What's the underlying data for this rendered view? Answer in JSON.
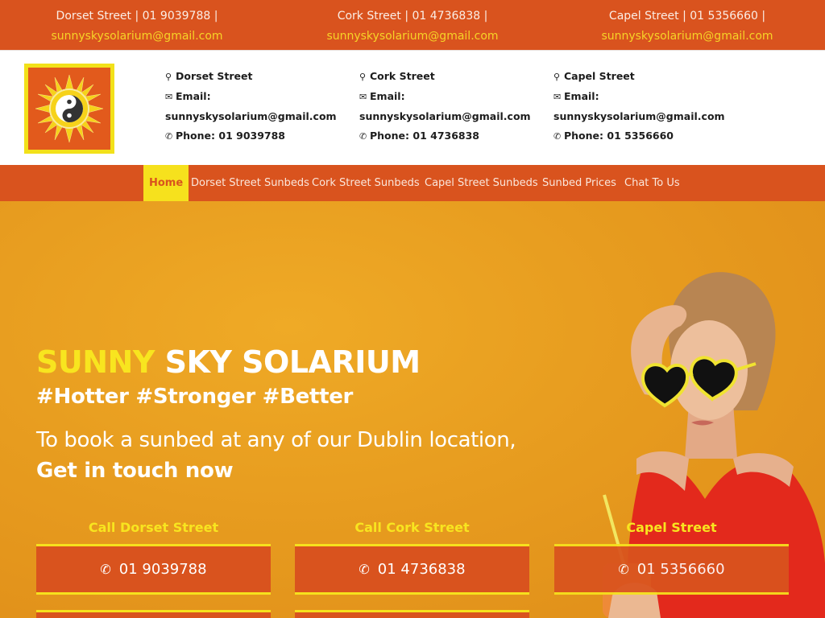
{
  "topbar": {
    "locations": [
      {
        "address": "Dorset Street | 01 9039788 |",
        "email": "sunnyskysolarium@gmail.com"
      },
      {
        "address": "Cork Street | 01 4736838 |",
        "email": "sunnyskysolarium@gmail.com"
      },
      {
        "address": "Capel Street | 01 5356660 |",
        "email": "sunnyskysolarium@gmail.com"
      }
    ]
  },
  "header": {
    "logo_icon": "sun-yin-yang-logo",
    "locations": [
      {
        "name": "Dorset Street",
        "email_label": "Email:",
        "email": "sunnyskysolarium@gmail.com",
        "phone": "Phone: 01 9039788"
      },
      {
        "name": "Cork Street",
        "email_label": "Email:",
        "email": "sunnyskysolarium@gmail.com",
        "phone": "Phone: 01 4736838"
      },
      {
        "name": "Capel Street",
        "email_label": "Email:",
        "email": "sunnyskysolarium@gmail.com",
        "phone": "Phone: 01 5356660"
      }
    ]
  },
  "nav": {
    "items": [
      {
        "label": "Home",
        "active": true
      },
      {
        "label": "Dorset Street Sunbeds"
      },
      {
        "label": "Cork Street Sunbeds"
      },
      {
        "label": "Capel Street Sunbeds"
      },
      {
        "label": "Sunbed Prices"
      },
      {
        "label": "Chat To Us"
      }
    ]
  },
  "hero": {
    "title_highlight": "SUNNY",
    "title_rest": "SKY SOLARIUM",
    "tags": "#Hotter #Stronger #Better",
    "book_text": "To book a sunbed at any of our Dublin location,",
    "cta": "Get in touch now",
    "calls": [
      {
        "label": "Call Dorset Street",
        "phone": "01 9039788"
      },
      {
        "label": "Call Cork Street",
        "phone": "01 4736838"
      },
      {
        "label": "Capel Street",
        "phone": "01 5356660"
      }
    ]
  },
  "colors": {
    "brand_orange": "#d9531e",
    "brand_yellow": "#f6e11d",
    "hero_bg": "#e79c1f"
  }
}
